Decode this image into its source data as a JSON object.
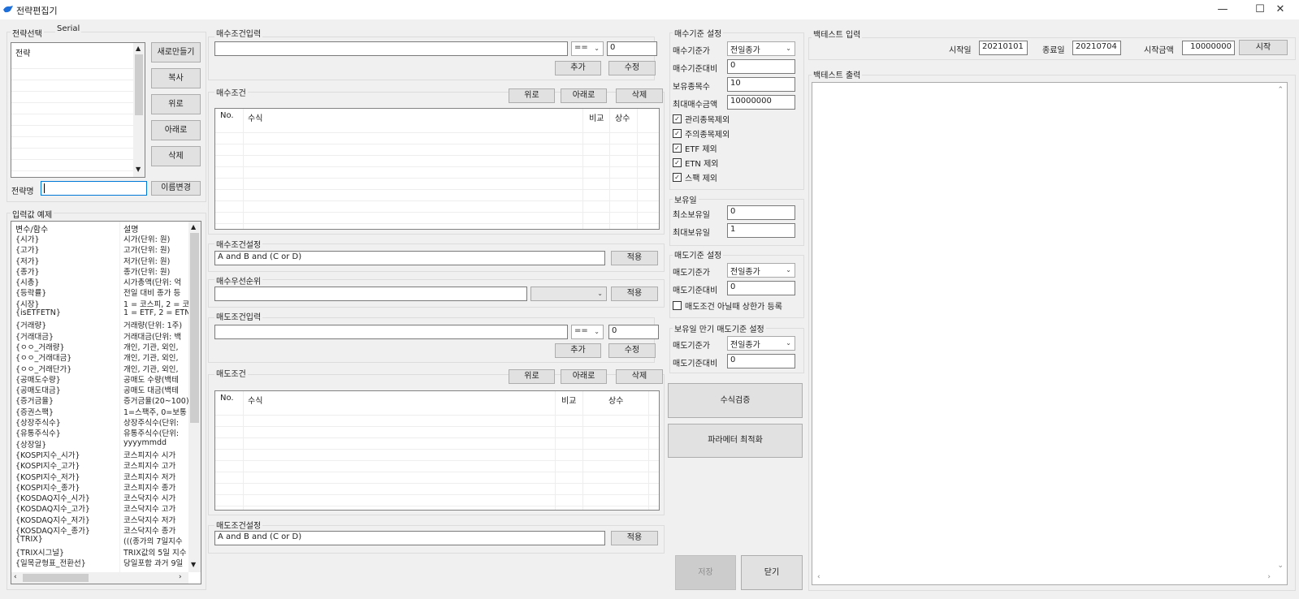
{
  "window": {
    "title": "전략편집기"
  },
  "strategy_select": {
    "group_label": "전략선택",
    "serial_label": "Serial",
    "list_header": "전략",
    "buttons": {
      "new": "새로만들기",
      "copy": "복사",
      "up": "위로",
      "down": "아래로",
      "delete": "삭제"
    },
    "name_label": "전략명",
    "name_value": "",
    "rename_button": "이름변경"
  },
  "input_examples": {
    "group_label": "입력값 예제",
    "col_var": "변수/함수",
    "col_desc": "설명",
    "rows": [
      {
        "var": "{시가}",
        "desc": "시가(단위: 원)"
      },
      {
        "var": "{고가}",
        "desc": "고가(단위: 원)"
      },
      {
        "var": "{저가}",
        "desc": "저가(단위: 원)"
      },
      {
        "var": "{종가}",
        "desc": "종가(단위: 원)"
      },
      {
        "var": "{시총}",
        "desc": "시가총액(단위: 억"
      },
      {
        "var": "{등락률}",
        "desc": "전일 대비 종가 등"
      },
      {
        "var": "{시장}",
        "desc": "1 = 코스피, 2 = 코"
      },
      {
        "var": "{isETFETN}",
        "desc": "1 = ETF, 2 = ETN"
      },
      {
        "var": "{거래량}",
        "desc": "거래량(단위: 1주)"
      },
      {
        "var": "{거래대금}",
        "desc": "거래대금(단위: 백"
      },
      {
        "var": "{ㅇㅇ_거래량}",
        "desc": "개인, 기관, 외인,"
      },
      {
        "var": "{ㅇㅇ_거래대금}",
        "desc": "개인, 기관, 외인,"
      },
      {
        "var": "{ㅇㅇ_거래단가}",
        "desc": "개인, 기관, 외인,"
      },
      {
        "var": "{공매도수량}",
        "desc": "공매도 수량(백테"
      },
      {
        "var": "{공매도대금}",
        "desc": "공매도 대금(백테"
      },
      {
        "var": "{증거금율}",
        "desc": "증거금율(20~100)"
      },
      {
        "var": "{증권스팩}",
        "desc": "1=스팩주, 0=보통"
      },
      {
        "var": "{상장주식수}",
        "desc": "상장주식수(단위:"
      },
      {
        "var": "{유통주식수}",
        "desc": "유통주식수(단위:"
      },
      {
        "var": "{상장일}",
        "desc": "yyyymmdd"
      },
      {
        "var": "{KOSPI지수_시가}",
        "desc": "코스피지수 시가"
      },
      {
        "var": "{KOSPI지수_고가}",
        "desc": "코스피지수 고가"
      },
      {
        "var": "{KOSPI지수_저가}",
        "desc": "코스피지수 저가"
      },
      {
        "var": "{KOSPI지수_종가}",
        "desc": "코스피지수 종가"
      },
      {
        "var": "{KOSDAQ지수_시가}",
        "desc": "코스닥지수 시가"
      },
      {
        "var": "{KOSDAQ지수_고가}",
        "desc": "코스닥지수 고가"
      },
      {
        "var": "{KOSDAQ지수_저가}",
        "desc": "코스닥지수 저가"
      },
      {
        "var": "{KOSDAQ지수_종가}",
        "desc": "코스닥지수 종가"
      },
      {
        "var": "{TRIX}",
        "desc": "(((종가의 7일지수"
      },
      {
        "var": "{TRIX시그널}",
        "desc": "TRIX값의 5일 지수"
      },
      {
        "var": "{일목균형표_전환선}",
        "desc": "당일포함 과거 9일"
      }
    ]
  },
  "buy_input": {
    "group_label": "매수조건입력",
    "expr_value": "",
    "operator": "==",
    "const_value": "0",
    "add_button": "추가",
    "edit_button": "수정"
  },
  "buy_conditions": {
    "group_label": "매수조건",
    "up_button": "위로",
    "down_button": "아래로",
    "delete_button": "삭제",
    "columns": [
      "No.",
      "수식",
      "비교",
      "상수"
    ]
  },
  "buy_setting": {
    "group_label": "매수조건설정",
    "value": "A and B and (C or D)",
    "apply_button": "적용"
  },
  "buy_priority": {
    "group_label": "매수우선순위",
    "value": "",
    "select_value": "",
    "apply_button": "적용"
  },
  "sell_input": {
    "group_label": "매도조건입력",
    "expr_value": "",
    "operator": "==",
    "const_value": "0",
    "add_button": "추가",
    "edit_button": "수정"
  },
  "sell_conditions": {
    "group_label": "매도조건",
    "up_button": "위로",
    "down_button": "아래로",
    "delete_button": "삭제",
    "columns": [
      "No.",
      "수식",
      "비교",
      "상수"
    ]
  },
  "sell_setting": {
    "group_label": "매도조건설정",
    "value": "A and B and (C or D)",
    "apply_button": "적용"
  },
  "buy_criteria": {
    "group_label": "매수기준 설정",
    "price_label": "매수기준가",
    "price_value": "전일종가",
    "ratio_label": "매수기준대비",
    "ratio_value": "0",
    "holdings_label": "보유종목수",
    "holdings_value": "10",
    "max_amount_label": "최대매수금액",
    "max_amount_value": "10000000",
    "checkboxes": [
      {
        "label": "관리종목제외",
        "checked": true
      },
      {
        "label": "주의종목제외",
        "checked": true
      },
      {
        "label": "ETF 제외",
        "checked": true
      },
      {
        "label": "ETN 제외",
        "checked": true
      },
      {
        "label": "스팩 제외",
        "checked": true
      }
    ]
  },
  "holding_days": {
    "group_label": "보유일",
    "min_label": "최소보유일",
    "min_value": "0",
    "max_label": "최대보유일",
    "max_value": "1"
  },
  "sell_criteria": {
    "group_label": "매도기준 설정",
    "price_label": "매도기준가",
    "price_value": "전일종가",
    "ratio_label": "매도기준대비",
    "ratio_value": "0",
    "checkbox_label": "매도조건 아닐때 상한가 등록",
    "checkbox_checked": false
  },
  "expiry_sell": {
    "group_label": "보유일 만기 매도기준 설정",
    "price_label": "매도기준가",
    "price_value": "전일종가",
    "ratio_label": "매도기준대비",
    "ratio_value": "0"
  },
  "actions": {
    "verify": "수식검증",
    "optimize": "파라메터 최적화",
    "save": "저장",
    "close": "닫기"
  },
  "backtest_input": {
    "group_label": "백테스트 입력",
    "start_label": "시작일",
    "start_value": "20210101",
    "end_label": "종료일",
    "end_value": "20210704",
    "amount_label": "시작금액",
    "amount_value": "10000000",
    "start_button": "시작"
  },
  "backtest_output": {
    "group_label": "백테스트 출력"
  }
}
